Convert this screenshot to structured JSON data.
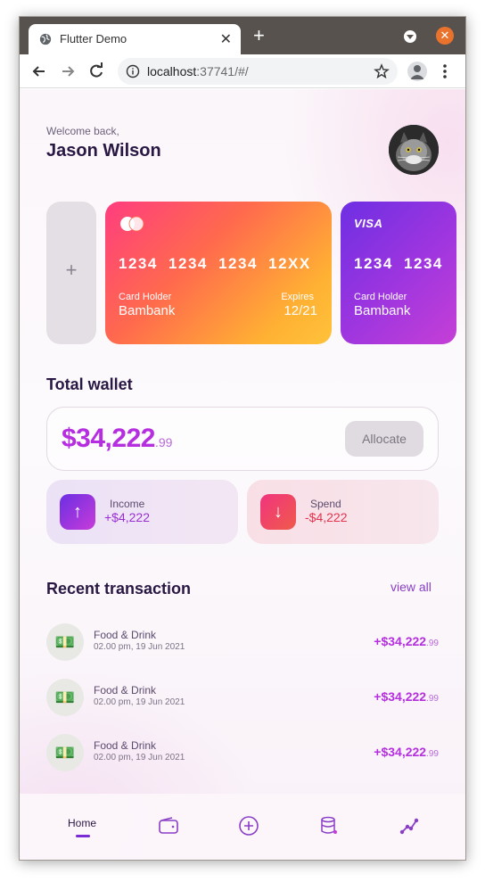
{
  "browser": {
    "tab_title": "Flutter Demo",
    "url_host": "localhost",
    "url_rest": ":37741/#/"
  },
  "header": {
    "welcome": "Welcome back,",
    "name": "Jason Wilson"
  },
  "cards": [
    {
      "brand": "mastercard",
      "number": "1234 1234 1234 12XX",
      "holder_label": "Card Holder",
      "holder": "Bambank",
      "expires_label": "Expires",
      "expires": "12/21"
    },
    {
      "brand": "VISA",
      "number": "1234 1234",
      "holder_label": "Card Holder",
      "holder": "Bambank"
    }
  ],
  "add_card": {
    "label": "+"
  },
  "wallet": {
    "title": "Total wallet",
    "amount": "$34,222",
    "cents": ".99",
    "allocate_label": "Allocate"
  },
  "income": {
    "label": "Income",
    "value": "+$4,222",
    "icon": "↑"
  },
  "spend": {
    "label": "Spend",
    "value": "-$4,222",
    "icon": "↓"
  },
  "transactions": {
    "title": "Recent transaction",
    "view_all": "view all",
    "items": [
      {
        "icon": "💵",
        "name": "Food & Drink",
        "date": "02.00 pm, 19 Jun 2021",
        "amount": "+$34,222",
        "cents": ".99"
      },
      {
        "icon": "💵",
        "name": "Food & Drink",
        "date": "02.00 pm, 19 Jun 2021",
        "amount": "+$34,222",
        "cents": ".99"
      },
      {
        "icon": "💵",
        "name": "Food & Drink",
        "date": "02.00 pm, 19 Jun 2021",
        "amount": "+$34,222",
        "cents": ".99"
      }
    ]
  },
  "bottom_nav": {
    "home_label": "Home",
    "items": [
      "home",
      "wallet-icon",
      "add-circle-icon",
      "database-icon",
      "chart-icon"
    ]
  },
  "colors": {
    "accent": "#b52ee0",
    "primary_text": "#2a1844",
    "spend": "#e8314d"
  }
}
